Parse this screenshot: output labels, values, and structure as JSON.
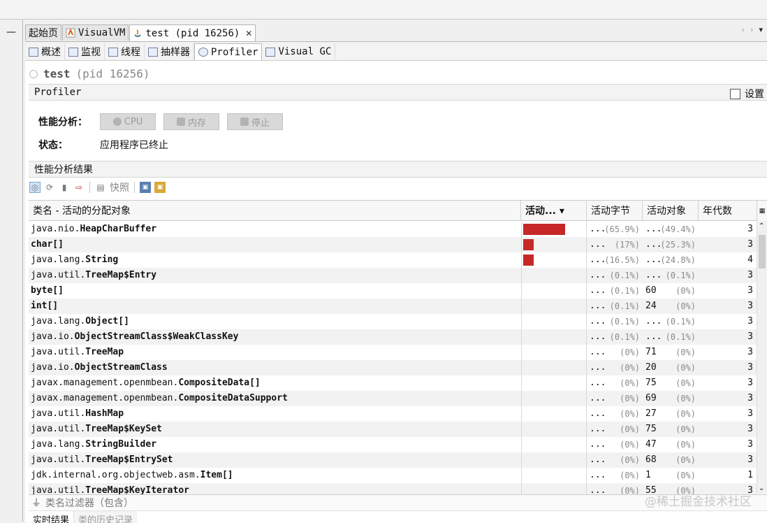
{
  "window": {
    "minimize_glyph": "—",
    "nav_left": "‹",
    "nav_right": "›",
    "nav_menu": "▾"
  },
  "doc_tabs": [
    {
      "label": "起始页",
      "icon": "none"
    },
    {
      "label": "VisualVM",
      "icon": "visualvm-icon"
    },
    {
      "label": "test (pid 16256)",
      "icon": "java-icon",
      "close": "✕"
    }
  ],
  "sub_tabs": [
    {
      "label": "概述"
    },
    {
      "label": "监视"
    },
    {
      "label": "线程"
    },
    {
      "label": "抽样器"
    },
    {
      "label": "Profiler"
    },
    {
      "label": "Visual GC"
    }
  ],
  "app": {
    "name": "test",
    "pid": "(pid 16256)"
  },
  "profiler_section": {
    "title": "Profiler",
    "settings_label": "设置"
  },
  "profile": {
    "label": "性能分析：",
    "cpu": "CPU",
    "memory": "内存",
    "stop": "停止"
  },
  "status": {
    "label": "状态：",
    "value": "应用程序已终止"
  },
  "results": {
    "title": "性能分析结果",
    "snapshot": "快照"
  },
  "table": {
    "headers": {
      "name": "类名 - 活动的分配对象",
      "live": "活动... ▾",
      "bytes": "活动字节",
      "objects": "活动对象",
      "generations": "年代数"
    },
    "rows": [
      {
        "pre": "java.nio.",
        "cls": "HeapCharBuffer",
        "share": 65.9,
        "bytes": "...",
        "bytes_pct": "(65.9%)",
        "objs": "...",
        "objs_pct": "(49.4%)",
        "gen": "3"
      },
      {
        "pre": "",
        "cls": "char[]",
        "share": 17,
        "bytes": "...",
        "bytes_pct": "(17%)",
        "objs": "...",
        "objs_pct": "(25.3%)",
        "gen": "3"
      },
      {
        "pre": "java.lang.",
        "cls": "String",
        "share": 16.5,
        "bytes": "...",
        "bytes_pct": "(16.5%)",
        "objs": "...",
        "objs_pct": "(24.8%)",
        "gen": "4"
      },
      {
        "pre": "java.util.",
        "cls": "TreeMap$Entry",
        "share": 0,
        "bytes": "...",
        "bytes_pct": "(0.1%)",
        "objs": "...",
        "objs_pct": "(0.1%)",
        "gen": "3"
      },
      {
        "pre": "",
        "cls": "byte[]",
        "share": 0,
        "bytes": "...",
        "bytes_pct": "(0.1%)",
        "objs": "60",
        "objs_pct": "(0%)",
        "gen": "3"
      },
      {
        "pre": "",
        "cls": "int[]",
        "share": 0,
        "bytes": "...",
        "bytes_pct": "(0.1%)",
        "objs": "24",
        "objs_pct": "(0%)",
        "gen": "3"
      },
      {
        "pre": "java.lang.",
        "cls": "Object[]",
        "share": 0,
        "bytes": "...",
        "bytes_pct": "(0.1%)",
        "objs": "...",
        "objs_pct": "(0.1%)",
        "gen": "3"
      },
      {
        "pre": "java.io.",
        "cls": "ObjectStreamClass$WeakClassKey",
        "share": 0,
        "bytes": "...",
        "bytes_pct": "(0.1%)",
        "objs": "...",
        "objs_pct": "(0.1%)",
        "gen": "3"
      },
      {
        "pre": "java.util.",
        "cls": "TreeMap",
        "share": 0,
        "bytes": "...",
        "bytes_pct": "(0%)",
        "objs": "71",
        "objs_pct": "(0%)",
        "gen": "3"
      },
      {
        "pre": "java.io.",
        "cls": "ObjectStreamClass",
        "share": 0,
        "bytes": "...",
        "bytes_pct": "(0%)",
        "objs": "20",
        "objs_pct": "(0%)",
        "gen": "3"
      },
      {
        "pre": "javax.management.openmbean.",
        "cls": "CompositeData[]",
        "share": 0,
        "bytes": "...",
        "bytes_pct": "(0%)",
        "objs": "75",
        "objs_pct": "(0%)",
        "gen": "3"
      },
      {
        "pre": "javax.management.openmbean.",
        "cls": "CompositeDataSupport",
        "share": 0,
        "bytes": "...",
        "bytes_pct": "(0%)",
        "objs": "69",
        "objs_pct": "(0%)",
        "gen": "3"
      },
      {
        "pre": "java.util.",
        "cls": "HashMap",
        "share": 0,
        "bytes": "...",
        "bytes_pct": "(0%)",
        "objs": "27",
        "objs_pct": "(0%)",
        "gen": "3"
      },
      {
        "pre": "java.util.",
        "cls": "TreeMap$KeySet",
        "share": 0,
        "bytes": "...",
        "bytes_pct": "(0%)",
        "objs": "75",
        "objs_pct": "(0%)",
        "gen": "3"
      },
      {
        "pre": "java.lang.",
        "cls": "StringBuilder",
        "share": 0,
        "bytes": "...",
        "bytes_pct": "(0%)",
        "objs": "47",
        "objs_pct": "(0%)",
        "gen": "3"
      },
      {
        "pre": "java.util.",
        "cls": "TreeMap$EntrySet",
        "share": 0,
        "bytes": "...",
        "bytes_pct": "(0%)",
        "objs": "68",
        "objs_pct": "(0%)",
        "gen": "3"
      },
      {
        "pre": "jdk.internal.org.objectweb.asm.",
        "cls": "Item[]",
        "share": 0,
        "bytes": "...",
        "bytes_pct": "(0%)",
        "objs": "1",
        "objs_pct": "(0%)",
        "gen": "1"
      },
      {
        "pre": "java.util.",
        "cls": "TreeMap$KeyIterator",
        "share": 0,
        "bytes": "...",
        "bytes_pct": "(0%)",
        "objs": "55",
        "objs_pct": "(0%)",
        "gen": "3"
      }
    ]
  },
  "filter": {
    "placeholder": "类名过滤器（包含）"
  },
  "bottom_tabs": [
    {
      "label": "实时结果"
    },
    {
      "label": "类的历史记录"
    }
  ],
  "watermark": "@稀土掘金技术社区",
  "colors": {
    "bar": "#c62828",
    "alt_row": "#f2f2f2"
  }
}
